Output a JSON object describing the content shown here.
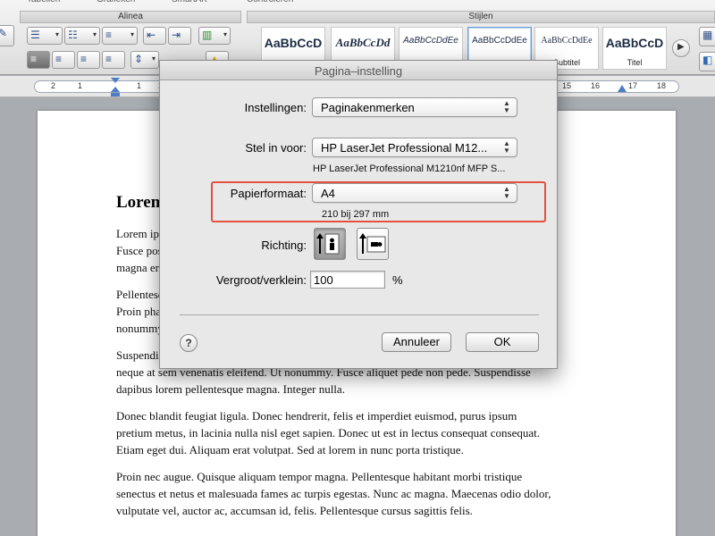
{
  "ribbon": {
    "tabs": [
      "Tabellen",
      "Grafieken",
      "SmartArt",
      "Controleren"
    ],
    "groups": {
      "alinea": "Alinea",
      "stijlen": "Stijlen"
    },
    "styles": [
      {
        "sample": "AaBbCcD",
        "name": ""
      },
      {
        "sample": "AaBbCcDd",
        "name": ""
      },
      {
        "sample": "AaBbCcDdEe",
        "name": ""
      },
      {
        "sample": "AaBbCcDdEe",
        "name": ""
      },
      {
        "sample": "AaBbCcDdEe",
        "name": "Subtitel"
      },
      {
        "sample": "AaBbCcD",
        "name": "Titel"
      }
    ]
  },
  "ruler": {
    "numbers": [
      "2",
      "1",
      "1",
      "2",
      "15",
      "16",
      "17",
      "18"
    ]
  },
  "document": {
    "heading": "Lorem",
    "paragraphs": [
      {
        "lines": [
          "Lorem ipsum dolor sit amet, consectetuer adipiscing elit. Maecenas porttitor congue massa.",
          "Fusce posuere, magna sed pulvinar ultricies, purus lectus malesuada libero, sit amet commodo",
          "magna eros quis urna."
        ]
      },
      {
        "lines": [
          "Pellentesque habitant morbi tristique senectus et netus et malesuada fames ac turpis egestas.",
          "Proin pharetra nonummy pede. Mauris et orci. Aenean nec lorem. In porttitor. Donec laoreet",
          "nonummy augue."
        ]
      },
      {
        "lines": [
          "Suspendisse dui purus, scelerisque at, vulputate vitae, pretium mattis, nunc. Mauris eget",
          "neque at sem venenatis eleifend. Ut nonummy. Fusce aliquet pede non pede. Suspendisse",
          "dapibus lorem pellentesque magna. Integer nulla."
        ]
      },
      {
        "lines": [
          "Donec blandit feugiat ligula. Donec hendrerit, felis et imperdiet euismod, purus ipsum",
          "pretium metus, in lacinia nulla nisl eget sapien. Donec ut est in lectus consequat consequat.",
          "Etiam eget dui. Aliquam erat volutpat. Sed at lorem in nunc porta tristique."
        ]
      },
      {
        "lines": [
          "Proin nec augue. Quisque aliquam tempor magna. Pellentesque habitant morbi tristique",
          "senectus et netus et malesuada fames ac turpis egestas. Nunc ac magna. Maecenas odio dolor,",
          "vulputate vel, auctor ac, accumsan id, felis. Pellentesque cursus sagittis felis."
        ]
      }
    ]
  },
  "dialog": {
    "title": "Pagina–instelling",
    "settings": {
      "label": "Instellingen:",
      "value": "Paginakenmerken"
    },
    "format_for": {
      "label": "Stel in voor:",
      "value": "HP LaserJet Professional M12...",
      "detail": "HP LaserJet Professional M1210nf MFP S..."
    },
    "paper_size": {
      "label": "Papierformaat:",
      "value": "A4",
      "detail": "210 bij 297 mm"
    },
    "orientation": {
      "label": "Richting:"
    },
    "scale": {
      "label": "Vergroot/verklein:",
      "value": "100",
      "unit": "%"
    },
    "help": "?",
    "buttons": {
      "cancel": "Annuleer",
      "ok": "OK"
    },
    "highlight_color": "#e2523f"
  }
}
